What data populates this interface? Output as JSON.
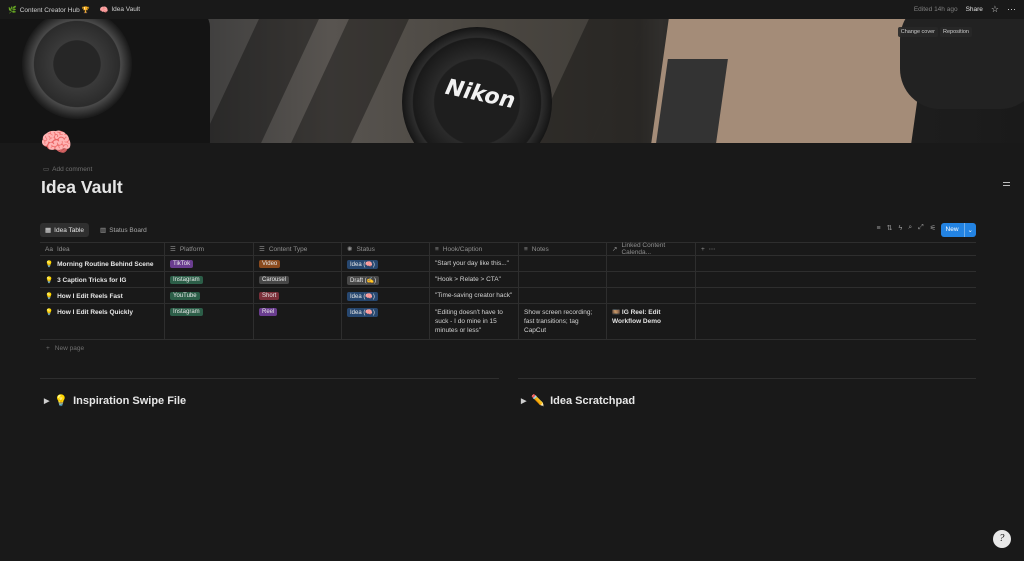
{
  "breadcrumb": {
    "workspace_emoji": "🌿",
    "workspace": "Content Creator Hub 🏆",
    "page_emoji": "🧠",
    "page": "Idea Vault"
  },
  "topbar": {
    "edited": "Edited 14h ago",
    "share": "Share"
  },
  "cover": {
    "change_cover": "Change cover",
    "reposition": "Reposition",
    "cap_text": "Nikon"
  },
  "page": {
    "icon": "🧠",
    "add_comment": "Add comment",
    "title": "Idea Vault"
  },
  "views": {
    "tabs": [
      {
        "label": "Idea Table",
        "icon": "table-icon"
      },
      {
        "label": "Status Board",
        "icon": "board-icon"
      }
    ],
    "new_label": "New"
  },
  "table": {
    "columns": [
      {
        "label": "Idea",
        "icon": "Aa"
      },
      {
        "label": "Platform",
        "icon": "☰"
      },
      {
        "label": "Content Type",
        "icon": "☰"
      },
      {
        "label": "Status",
        "icon": "✺"
      },
      {
        "label": "Hook/Caption",
        "icon": "≡"
      },
      {
        "label": "Notes",
        "icon": "≡"
      },
      {
        "label": "Linked Content Calenda...",
        "icon": "↗"
      }
    ],
    "rows": [
      {
        "idea": "Morning Routine Behind Scene",
        "platform": "TikTok",
        "type": "Video",
        "status": "Idea (🧠)",
        "hook": "\"Start your day like this...\"",
        "notes": "",
        "linked": ""
      },
      {
        "idea": "3 Caption Tricks for IG",
        "platform": "Instagram",
        "type": "Carousel",
        "status": "Draft (✍)",
        "hook": "\"Hook > Relate > CTA\"",
        "notes": "",
        "linked": ""
      },
      {
        "idea": "How I Edit Reels Fast",
        "platform": "YouTube",
        "type": "Short",
        "status": "Idea (🧠)",
        "hook": "\"Time-saving creator hack\"",
        "notes": "",
        "linked": ""
      },
      {
        "idea": "How I Edit Reels Quickly",
        "platform": "Instagram",
        "type": "Reel",
        "status": "Idea (🧠)",
        "hook": "\"Editing doesn't have to suck - I do mine in 15 minutes or less\"",
        "notes": "Show screen recording; fast transitions; tag CapCut",
        "linked": "🎞️ IG Reel: Edit Workflow Demo"
      }
    ],
    "idea_emoji": "💡",
    "new_page": "New page"
  },
  "toggles": {
    "left": {
      "emoji": "💡",
      "label": "Inspiration Swipe File"
    },
    "right": {
      "emoji": "✏️",
      "label": "Idea Scratchpad"
    }
  },
  "help": "?"
}
